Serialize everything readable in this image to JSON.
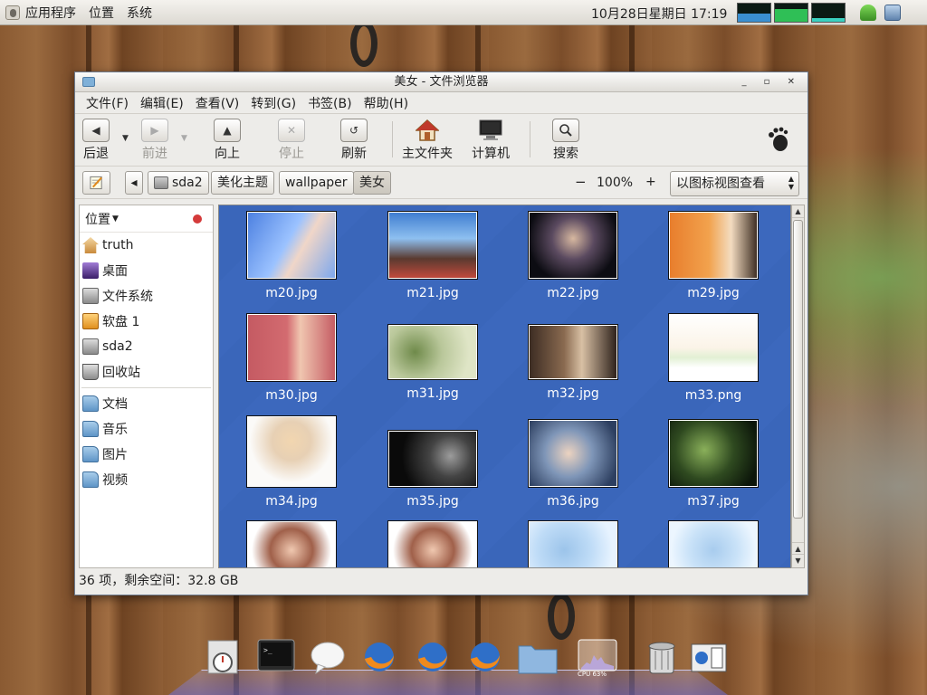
{
  "top_panel": {
    "menus": [
      "应用程序",
      "位置",
      "系统"
    ],
    "clock": "10月28日星期日 17:19"
  },
  "window": {
    "title": "美女 - 文件浏览器",
    "menubar": [
      "文件(F)",
      "编辑(E)",
      "查看(V)",
      "转到(G)",
      "书签(B)",
      "帮助(H)"
    ],
    "toolbar": {
      "back": "后退",
      "forward": "前进",
      "up": "向上",
      "stop": "停止",
      "reload": "刷新",
      "home": "主文件夹",
      "computer": "计算机",
      "search": "搜索"
    },
    "location": {
      "crumbs": [
        "sda2",
        "美化主题",
        "wallpaper",
        "美女"
      ],
      "zoom": "100%",
      "zoom_minus": "−",
      "zoom_plus": "+",
      "view_mode": "以图标视图查看"
    },
    "sidepane": {
      "header": "位置",
      "places": [
        "truth",
        "桌面",
        "文件系统",
        "软盘 1",
        "sda2",
        "回收站"
      ],
      "bookmarks": [
        "文档",
        "音乐",
        "图片",
        "视频"
      ]
    },
    "files": [
      "m20.jpg",
      "m21.jpg",
      "m22.jpg",
      "m29.jpg",
      "m30.jpg",
      "m31.jpg",
      "m32.jpg",
      "m33.png",
      "m34.jpg",
      "m35.jpg",
      "m36.jpg",
      "m37.jpg",
      "",
      "",
      "",
      ""
    ],
    "status": "36 项，剩余空间：32.8 GB"
  },
  "dock": {
    "cpu_label": "CPU 63%"
  },
  "colors": {
    "icon_view_bg": "#3a66ba",
    "window_bg": "#edece9"
  }
}
